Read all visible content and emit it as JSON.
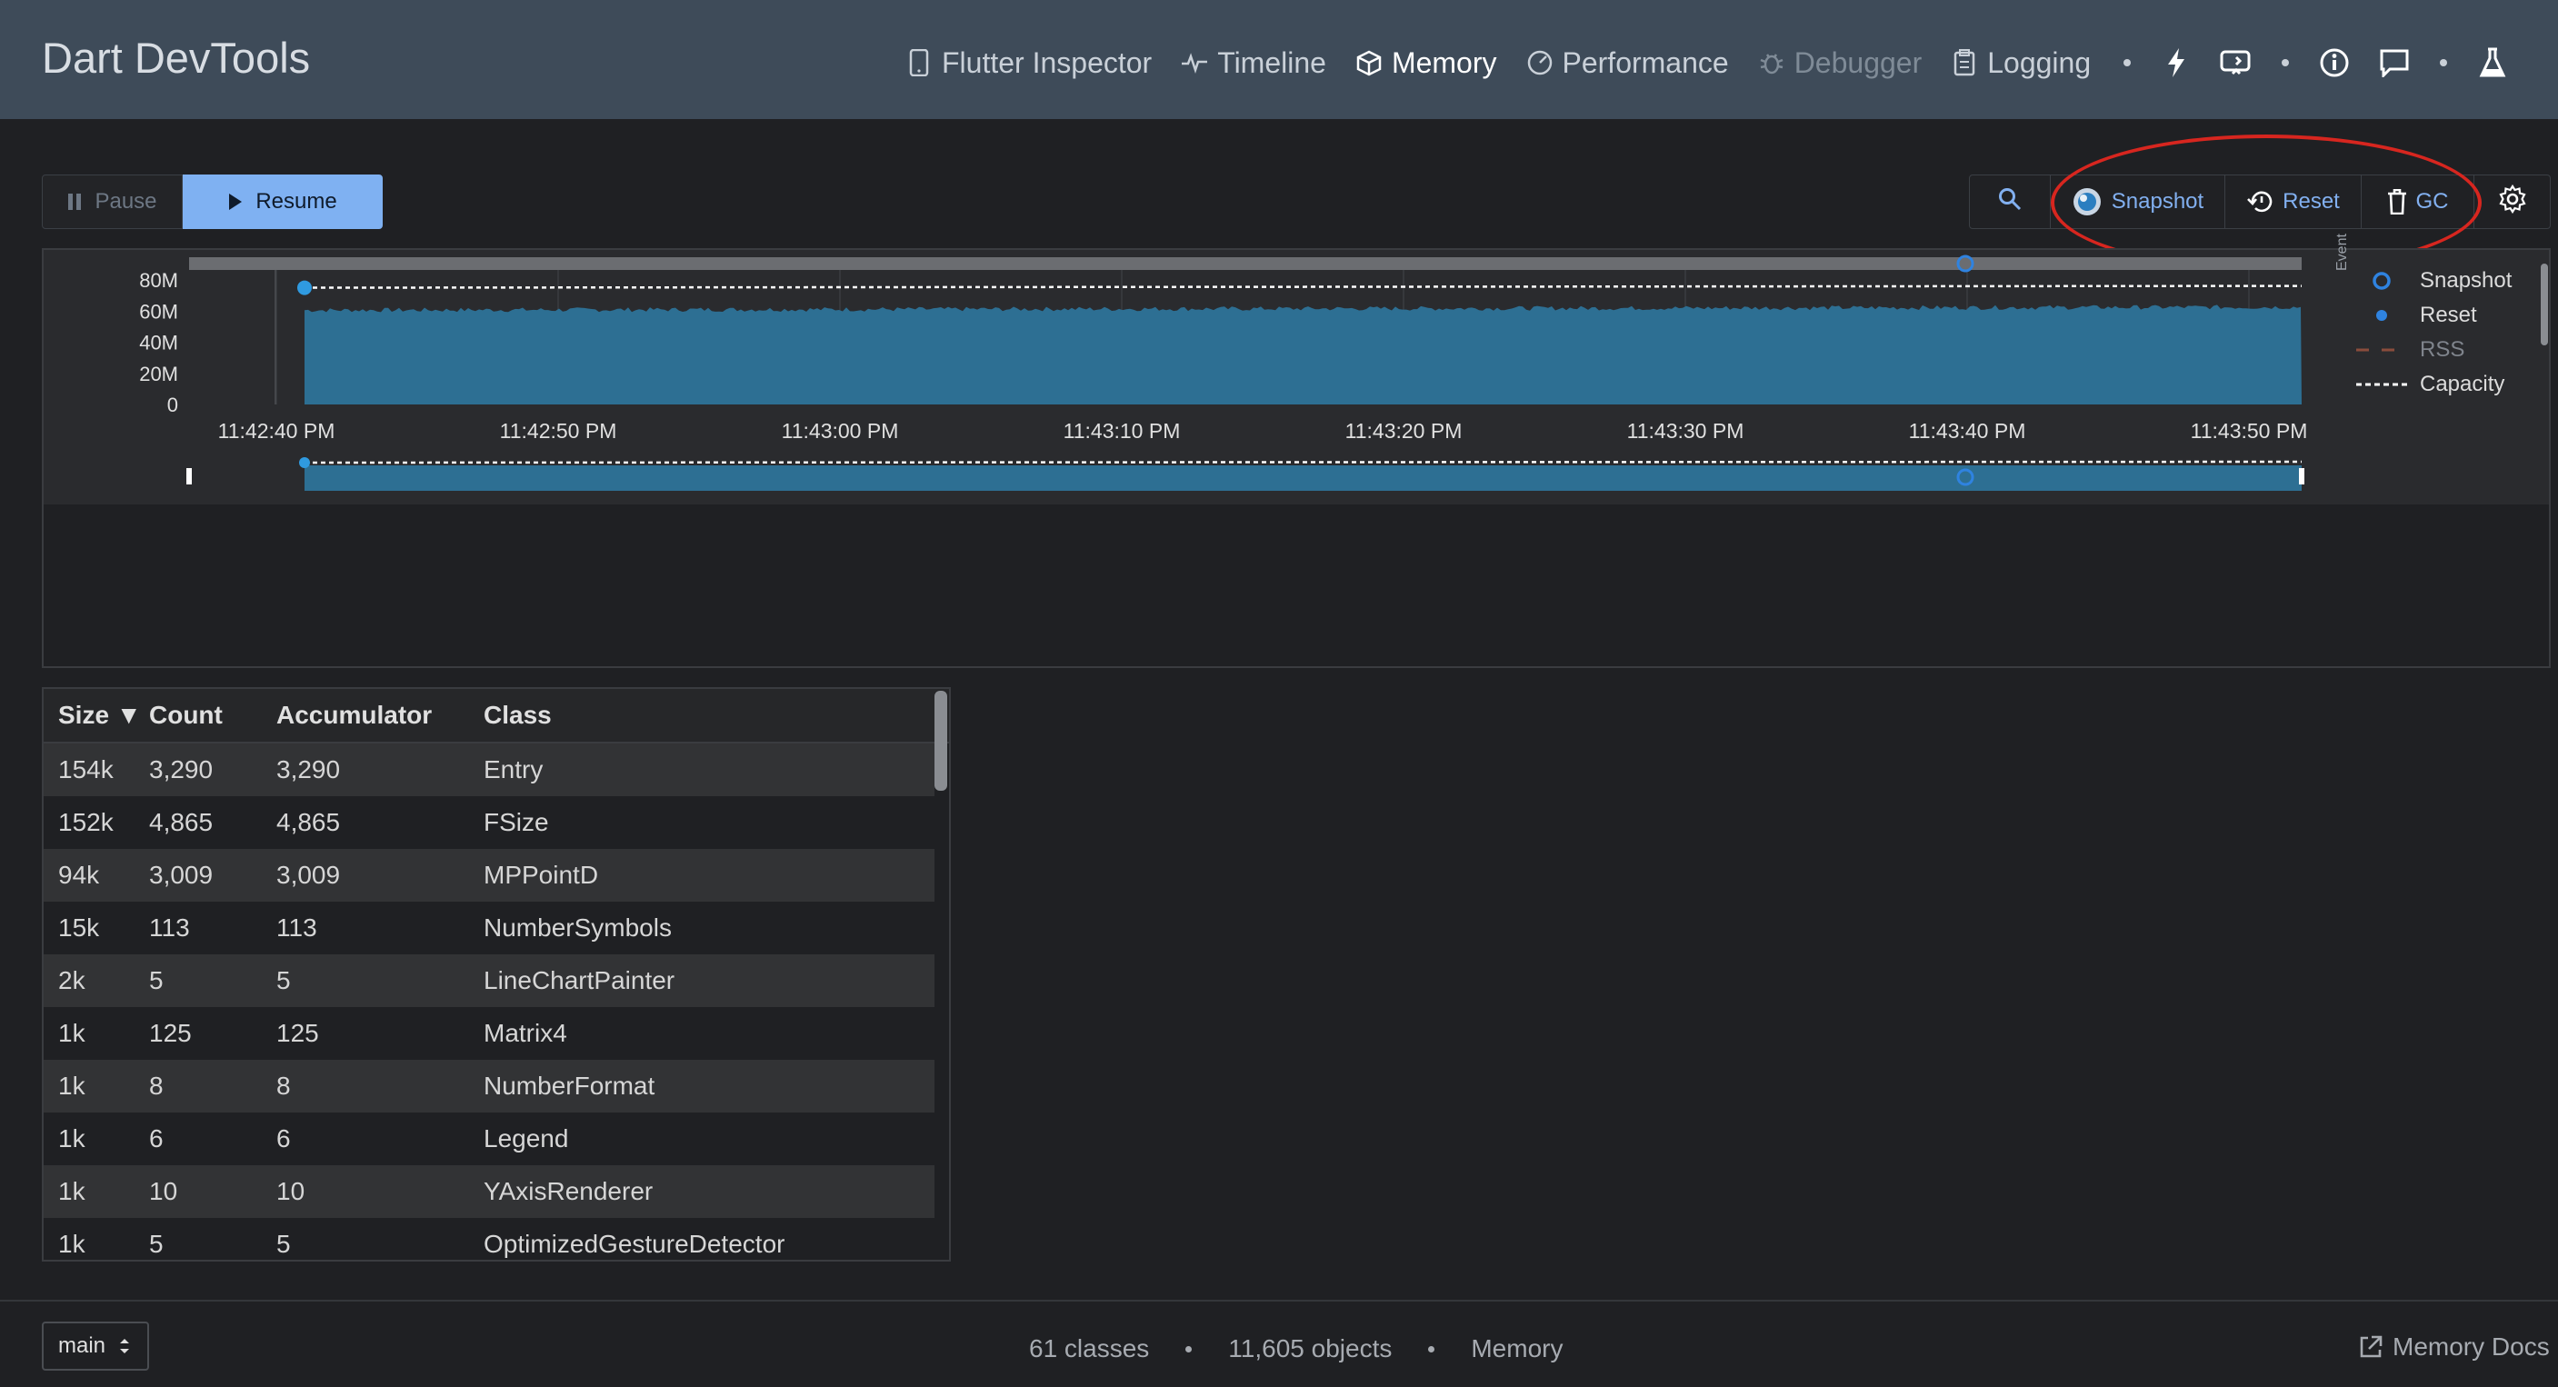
{
  "header": {
    "title": "Dart DevTools",
    "tabs": [
      {
        "label": "Flutter Inspector",
        "icon": "phone-icon"
      },
      {
        "label": "Timeline",
        "icon": "pulse-icon"
      },
      {
        "label": "Memory",
        "icon": "cube-icon",
        "active": true
      },
      {
        "label": "Performance",
        "icon": "gauge-icon"
      },
      {
        "label": "Debugger",
        "icon": "bug-icon",
        "disabled": true
      },
      {
        "label": "Logging",
        "icon": "clipboard-icon"
      }
    ],
    "actions": [
      "lightning-icon",
      "hot-restart-icon",
      "info-icon",
      "feedback-icon",
      "flask-icon"
    ]
  },
  "toolbar": {
    "pause_label": "Pause",
    "resume_label": "Resume",
    "snapshot_label": "Snapshot",
    "reset_label": "Reset",
    "gc_label": "GC"
  },
  "chart": {
    "legend": {
      "title": "Event",
      "items": [
        "Snapshot",
        "Reset",
        "RSS",
        "Capacity"
      ]
    }
  },
  "chart_data": {
    "type": "area",
    "y_ticks": [
      "80M",
      "60M",
      "40M",
      "20M",
      "0"
    ],
    "x_ticks": [
      "11:42:40 PM",
      "11:42:50 PM",
      "11:43:00 PM",
      "11:43:10 PM",
      "11:43:20 PM",
      "11:43:30 PM",
      "11:43:40 PM",
      "11:43:50 PM"
    ],
    "ylim": [
      0,
      80
    ],
    "series": [
      {
        "name": "Capacity",
        "style": "dashed-white",
        "value_approx_M": 75
      },
      {
        "name": "RSS",
        "style": "dashed-red"
      }
    ],
    "area_value_approx_M": 60,
    "area_color": "#2d6f93",
    "events": [
      {
        "type": "Reset",
        "time": "11:42:42 PM"
      },
      {
        "type": "Snapshot",
        "time": "11:43:40 PM"
      }
    ]
  },
  "table": {
    "columns": [
      "Size",
      "Count",
      "Accumulator",
      "Class"
    ],
    "sort_indicator": "▼",
    "rows": [
      [
        "154k",
        "3,290",
        "3,290",
        "Entry"
      ],
      [
        "152k",
        "4,865",
        "4,865",
        "FSize"
      ],
      [
        "94k",
        "3,009",
        "3,009",
        "MPPointD"
      ],
      [
        "15k",
        "113",
        "113",
        "NumberSymbols"
      ],
      [
        "2k",
        "5",
        "5",
        "LineChartPainter"
      ],
      [
        "1k",
        "125",
        "125",
        "Matrix4"
      ],
      [
        "1k",
        "8",
        "8",
        "NumberFormat"
      ],
      [
        "1k",
        "6",
        "6",
        "Legend"
      ],
      [
        "1k",
        "10",
        "10",
        "YAxisRenderer"
      ],
      [
        "1k",
        "5",
        "5",
        "OptimizedGestureDetector"
      ]
    ]
  },
  "footer": {
    "isolate": "main",
    "classes": "61 classes",
    "objects": "11,605 objects",
    "page": "Memory",
    "docs_label": "Memory Docs"
  },
  "colors": {
    "header_bg": "#3e4b59",
    "accent_blue": "#7fb1f2",
    "area_fill": "#2d6f93",
    "annotation_red": "#d7261f"
  }
}
